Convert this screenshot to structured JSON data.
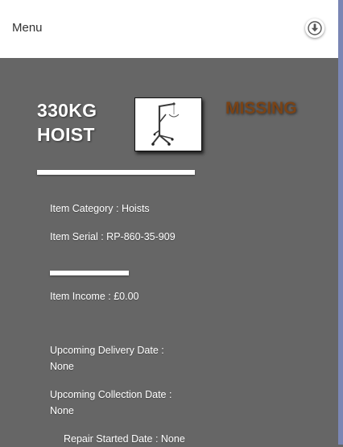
{
  "header": {
    "menu_label": "Menu",
    "download_icon": "download-circle-icon"
  },
  "item": {
    "title_line1": "330KG",
    "title_line2": "HOIST",
    "status": "MISSING",
    "status_color": "#7a4316",
    "image_icon": "hoist-photo"
  },
  "details": {
    "category_label": "Item Category : ",
    "category_value": "Hoists",
    "serial_label": "Item Serial : ",
    "serial_value": "RP-860-35-909",
    "income_label": "Item Income : ",
    "income_value": "£0.00",
    "delivery_label": "Upcoming Delivery Date :",
    "delivery_value": "None",
    "collection_label": "Upcoming Collection Date :",
    "collection_value": "None",
    "repair_label": "Repair Started Date : ",
    "repair_value": "None"
  },
  "colors": {
    "background": "#666666",
    "topbar": "#ffffff",
    "accent_strip": "#7a86b4"
  }
}
